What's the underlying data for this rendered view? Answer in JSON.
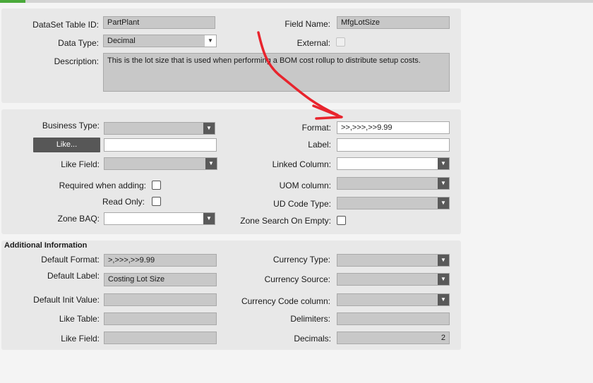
{
  "colors": {
    "accent": "#4aa93a",
    "annotation_arrow": "#e8242d"
  },
  "general": {
    "dataset_table_id": {
      "label": "DataSet Table ID:",
      "value": "PartPlant"
    },
    "field_name": {
      "label": "Field Name:",
      "value": "MfgLotSize"
    },
    "data_type": {
      "label": "Data Type:",
      "value": "Decimal"
    },
    "external": {
      "label": "External:",
      "checked": false
    },
    "description": {
      "label": "Description:",
      "value": "This is the lot size that is used when performing a BOM cost rollup to distribute setup costs."
    }
  },
  "extended": {
    "business_type": {
      "label": "Business Type:",
      "value": ""
    },
    "format": {
      "label": "Format:",
      "value": ">>,>>>,>>9.99"
    },
    "like_button": {
      "label": "Like..."
    },
    "like_input": {
      "value": ""
    },
    "label_field": {
      "label": "Label:",
      "value": ""
    },
    "like_field": {
      "label": "Like Field:",
      "value": ""
    },
    "linked_column": {
      "label": "Linked Column:",
      "value": ""
    },
    "required_when_adding": {
      "label": "Required when adding:",
      "checked": false
    },
    "uom_column": {
      "label": "UOM column:",
      "value": ""
    },
    "read_only": {
      "label": "Read Only:",
      "checked": false
    },
    "ud_code_type": {
      "label": "UD Code Type:",
      "value": ""
    },
    "zone_baq": {
      "label": "Zone BAQ:",
      "value": ""
    },
    "zone_search_on_empty": {
      "label": "Zone Search On Empty:",
      "checked": false
    }
  },
  "additional": {
    "title": "Additional Information",
    "default_format": {
      "label": "Default Format:",
      "value": ">,>>>,>>9.99"
    },
    "currency_type": {
      "label": "Currency Type:",
      "value": ""
    },
    "default_label": {
      "label": "Default Label:",
      "value": "Costing Lot Size"
    },
    "currency_source": {
      "label": "Currency Source:",
      "value": ""
    },
    "default_init_value": {
      "label": "Default Init Value:",
      "value": ""
    },
    "currency_code_column": {
      "label": "Currency Code column:",
      "value": ""
    },
    "like_table": {
      "label": "Like Table:",
      "value": ""
    },
    "delimiters": {
      "label": "Delimiters:",
      "value": ""
    },
    "like_field": {
      "label": "Like Field:",
      "value": ""
    },
    "decimals": {
      "label": "Decimals:",
      "value": "2"
    }
  }
}
